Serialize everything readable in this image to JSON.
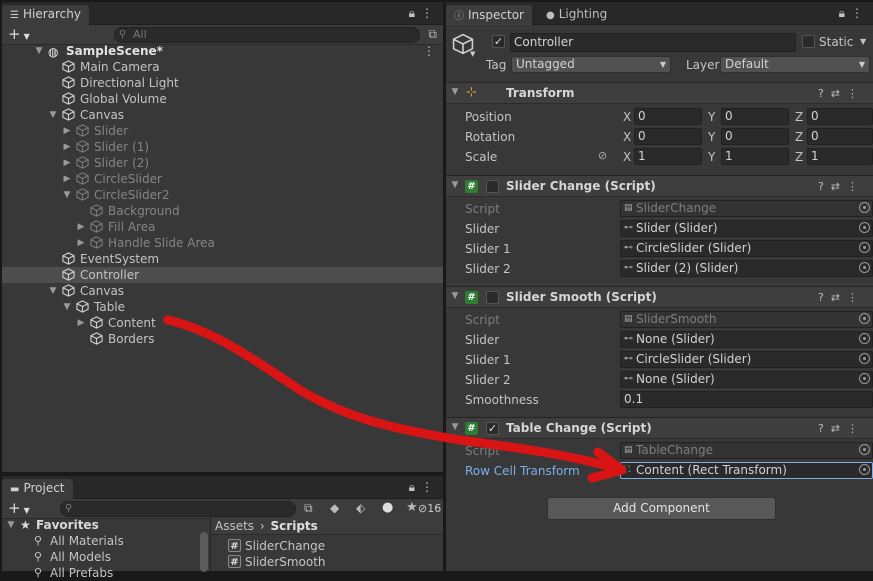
{
  "hierarchy": {
    "tab": "Hierarchy",
    "search_placeholder": "All",
    "add_label": "+",
    "rows": [
      {
        "label": "SampleScene*",
        "indent": 0
      },
      {
        "label": "Main Camera"
      },
      {
        "label": "Directional Light"
      },
      {
        "label": "Global Volume"
      },
      {
        "label": "Canvas"
      },
      {
        "label": "Slider"
      },
      {
        "label": "Slider (1)"
      },
      {
        "label": "Slider (2)"
      },
      {
        "label": "CircleSlider"
      },
      {
        "label": "CircleSlider2"
      },
      {
        "label": "Background"
      },
      {
        "label": "Fill Area"
      },
      {
        "label": "Handle Slide Area"
      },
      {
        "label": "EventSystem"
      },
      {
        "label": "Controller"
      },
      {
        "label": "Canvas"
      },
      {
        "label": "Table"
      },
      {
        "label": "Content"
      },
      {
        "label": "Borders"
      }
    ]
  },
  "project": {
    "tab": "Project",
    "add_label": "+",
    "hidden_count": "16",
    "favorites_label": "Favorites",
    "favorites": [
      "All Materials",
      "All Models",
      "All Prefabs"
    ],
    "breadcrumb": [
      "Assets",
      "Scripts"
    ],
    "files": [
      "SliderChange",
      "SliderSmooth"
    ]
  },
  "inspector": {
    "tabs": [
      "Inspector",
      "Lighting"
    ],
    "object_name": "Controller",
    "static_label": "Static",
    "tag_label": "Tag",
    "tag_value": "Untagged",
    "layer_label": "Layer",
    "layer_value": "Default",
    "transform": {
      "title": "Transform",
      "rows": [
        {
          "label": "Position",
          "x": "0",
          "y": "0",
          "z": "0"
        },
        {
          "label": "Rotation",
          "x": "0",
          "y": "0",
          "z": "0"
        },
        {
          "label": "Scale",
          "x": "1",
          "y": "1",
          "z": "1"
        }
      ]
    },
    "slider_change": {
      "title": "Slider Change (Script)",
      "props": [
        {
          "label": "Script",
          "value": "SliderChange"
        },
        {
          "label": "Slider",
          "value": "Slider (Slider)"
        },
        {
          "label": "Slider 1",
          "value": "CircleSlider (Slider)"
        },
        {
          "label": "Slider 2",
          "value": "Slider (2) (Slider)"
        }
      ]
    },
    "slider_smooth": {
      "title": "Slider Smooth (Script)",
      "props": [
        {
          "label": "Script",
          "value": "SliderSmooth"
        },
        {
          "label": "Slider",
          "value": "None (Slider)"
        },
        {
          "label": "Slider 1",
          "value": "CircleSlider (Slider)"
        },
        {
          "label": "Slider 2",
          "value": "None (Slider)"
        },
        {
          "label": "Smoothness",
          "value": "0.1"
        }
      ]
    },
    "table_change": {
      "title": "Table Change (Script)",
      "props": [
        {
          "label": "Script",
          "value": "TableChange"
        },
        {
          "label": "Row Cell Transform",
          "value": "Content (Rect Transform)"
        }
      ]
    },
    "add_component": "Add Component"
  },
  "axis": {
    "x": "X",
    "y": "Y",
    "z": "Z"
  },
  "colors": {
    "annotation": "#d81414",
    "link_label": "#7ab0e8"
  }
}
